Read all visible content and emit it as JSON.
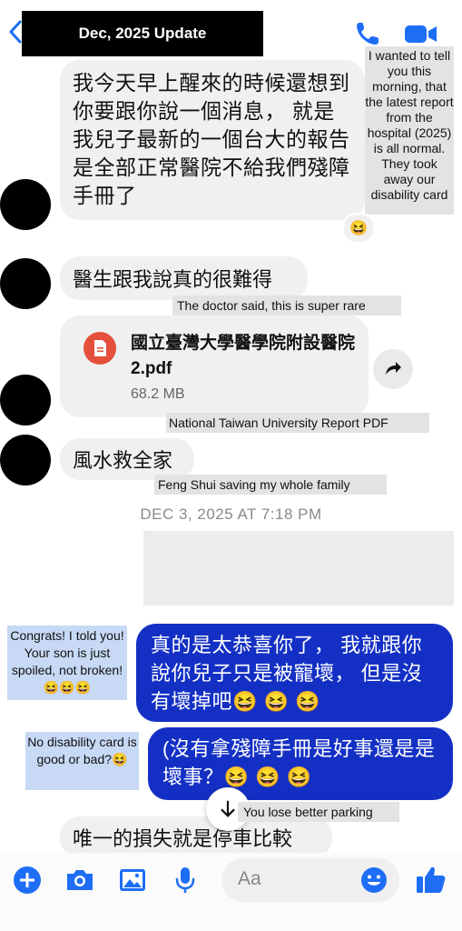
{
  "header": {
    "title": "Dec, 2025 Update",
    "accent_color": "#1e6ef5"
  },
  "notes": {
    "morning": "I wanted to tell you this morning, that the latest report from the hospital (2025) is all normal.  They took away our disability card",
    "doctor": "The doctor said, this is super rare",
    "pdf": "National Taiwan University Report PDF",
    "fengshui": "Feng Shui saving my whole family",
    "congrats": "Congrats! I told you! Your son is just spoiled, not broken! 😆😆😆",
    "card": "No disability card is good or bad?😆",
    "parking": "You lose better parking"
  },
  "messages": {
    "m1": "我今天早上醒來的時候還想到你要跟你說一個消息， 就是我兒子最新的一個台大的報告是全部正常醫院不給我們殘障手冊了",
    "m1_reaction": "😆",
    "m2": "醫生跟我說真的很難得",
    "file_name": "國立臺灣大學醫學院附設醫院 2.pdf",
    "file_size": "68.2 MB",
    "m3": "風水救全家",
    "timestamp": "DEC 3, 2025 AT 7:18 PM",
    "m4": "真的是太恭喜你了， 我就跟你說你兒子只是被寵壞， 但是沒有壞掉吧😆 😆 😆",
    "m5": "(沒有拿殘障手冊是好事還是是壞事？😆 😆 😆",
    "m6": "唯一的損失就是停車比較"
  },
  "composer": {
    "placeholder": "Aa",
    "icons": [
      "plus-icon",
      "camera-icon",
      "photo-icon",
      "microphone-icon",
      "emoji-icon",
      "thumbs-up-icon"
    ]
  },
  "colors": {
    "outgoing_bubble": "#1430c4",
    "incoming_bubble": "#f0f0f0",
    "pdf_red": "#e4503c"
  }
}
